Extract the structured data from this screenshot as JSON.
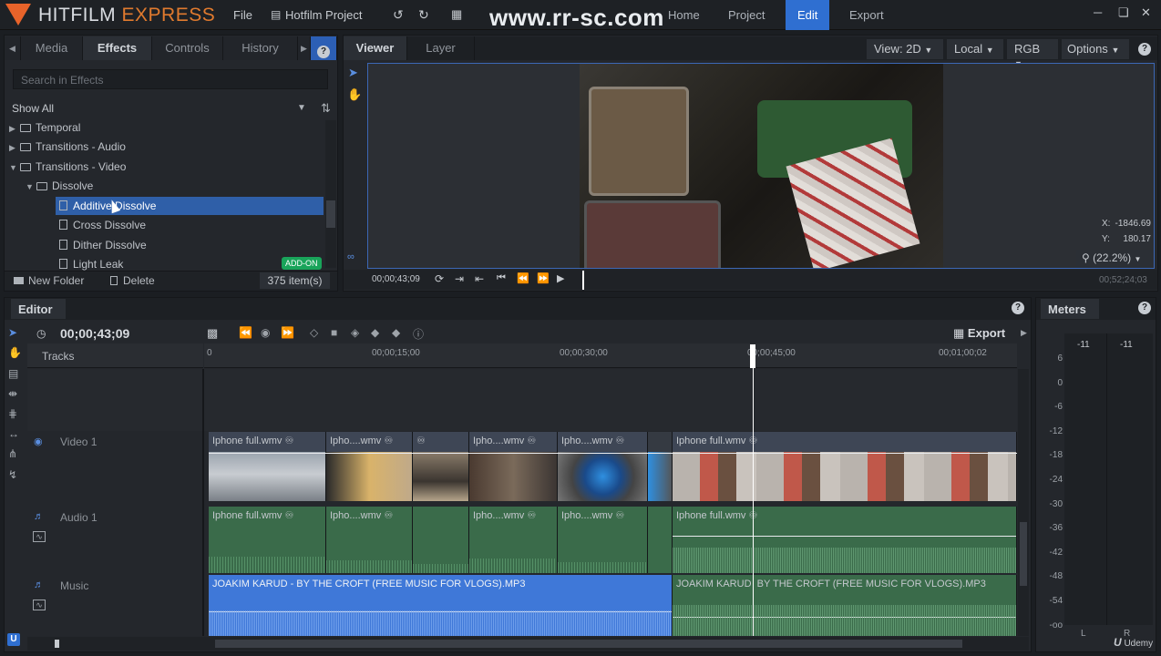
{
  "app": {
    "logo_main": "HITFILM",
    "logo_accent": "EXPRESS",
    "menu_file": "File",
    "project_name": "Hotfilm Project",
    "nav": [
      "Home",
      "Project",
      "Edit",
      "Export"
    ],
    "nav_active": "Edit",
    "watermark": "www.rr-sc.com"
  },
  "left_panel": {
    "tabs": [
      "Media",
      "Effects",
      "Controls",
      "History"
    ],
    "active_tab": "Effects",
    "search_placeholder": "Search in Effects",
    "filter": "Show All",
    "tree": [
      {
        "label": "Temporal",
        "type": "folder",
        "expanded": false
      },
      {
        "label": "Transitions - Audio",
        "type": "folder",
        "expanded": false
      },
      {
        "label": "Transitions - Video",
        "type": "folder",
        "expanded": true
      },
      {
        "label": "Dissolve",
        "type": "folder",
        "expanded": true
      },
      {
        "label": "Additive Dissolve",
        "type": "effect",
        "selected": true
      },
      {
        "label": "Cross Dissolve",
        "type": "effect"
      },
      {
        "label": "Dither Dissolve",
        "type": "effect"
      },
      {
        "label": "Light Leak",
        "type": "effect",
        "badge": "ADD-ON"
      }
    ],
    "new_folder": "New Folder",
    "delete": "Delete",
    "item_count": "375 item(s)"
  },
  "viewer": {
    "tabs": [
      "Viewer",
      "Layer"
    ],
    "active_tab": "Viewer",
    "view_mode": "View: 2D",
    "space": "Local",
    "channel": "RGB",
    "options": "Options",
    "coord_x_label": "X:",
    "coord_x": "-1846.69",
    "coord_y_label": "Y:",
    "coord_y": "180.17",
    "zoom": "(22.2%)",
    "timecode": "00;00;43;09",
    "duration": "00;52;24;03"
  },
  "editor": {
    "title": "Editor",
    "timecode": "00;00;43;09",
    "export_label": "Export",
    "tracks_label": "Tracks",
    "ruler_marks": [
      "0",
      "00;00;15;00",
      "00;00;30;00",
      "00;00;45;00",
      "00;01;00;02"
    ],
    "tracks": {
      "video1": "Video 1",
      "audio1": "Audio 1",
      "music": "Music"
    },
    "video_clips": [
      "Iphone full.wmv",
      "Ipho....wmv",
      "Ipho....wmv",
      "Ipho....wmv",
      "Iphone full.wmv"
    ],
    "audio_clips": [
      "Iphone full.wmv",
      "Ipho....wmv",
      "Ipho....wmv",
      "Ipho....wmv",
      "Iphone full.wmv"
    ],
    "music_clips": [
      "JOAKIM KARUD - BY THE CROFT (FREE MUSIC FOR VLOGS).MP3",
      "JOAKIM KARUD",
      "BY THE CROFT (FREE MUSIC FOR VLOGS).MP3"
    ]
  },
  "meters": {
    "title": "Meters",
    "peak_left": "-11",
    "peak_right": "-11",
    "scale": [
      "6",
      "0",
      "-6",
      "-12",
      "-18",
      "-24",
      "-30",
      "-36",
      "-42",
      "-48",
      "-54",
      "-oo"
    ],
    "channel_left": "L",
    "channel_right": "R",
    "brand": "Udemy"
  },
  "colors": {
    "accent": "#2f6fd1",
    "logo": "#e8632a",
    "addon": "#19a45a",
    "video_clip": "#3e4655",
    "audio_clip": "#3a6b4a",
    "music_clip": "#3f78d8"
  }
}
